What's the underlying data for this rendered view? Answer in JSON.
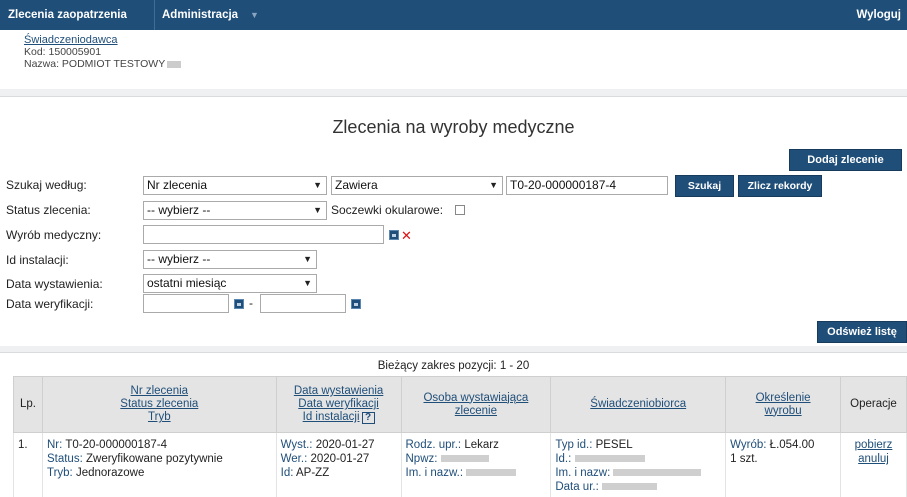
{
  "nav": {
    "orders": "Zlecenia zaopatrzenia",
    "admin": "Administracja",
    "logout": "Wyloguj"
  },
  "provider": {
    "label": "Świadczeniodawca",
    "code": "Kod: 150005901",
    "name": "Nazwa: PODMIOT TESTOWY"
  },
  "page_title": "Zlecenia na wyroby medyczne",
  "buttons": {
    "add": "Dodaj zlecenie",
    "search": "Szukaj",
    "count": "Zlicz rekordy",
    "refresh": "Odśwież listę"
  },
  "filters": {
    "search_by_label": "Szukaj według:",
    "search_by_value": "Nr zlecenia",
    "match_value": "Zawiera",
    "query_value": "T0-20-000000187-4",
    "status_label": "Status zlecenia:",
    "status_value": "-- wybierz --",
    "lenses_label": "Soczewki okularowe:",
    "product_label": "Wyrób medyczny:",
    "product_value": "",
    "install_label": "Id instalacji:",
    "install_value": "-- wybierz --",
    "issue_date_label": "Data wystawienia:",
    "issue_date_value": "ostatni miesiąc",
    "verify_date_label": "Data weryfikacji:",
    "date_sep": "-"
  },
  "range_text": "Bieżący zakres pozycji: 1 - 20",
  "table": {
    "headers": {
      "lp": "Lp.",
      "order_1": "Nr zlecenia",
      "order_2": "Status zlecenia",
      "order_3": "Tryb",
      "dates_1": "Data wystawienia",
      "dates_2": "Data weryfikacji",
      "dates_3": "Id instalacji",
      "help": "?",
      "issuer_1": "Osoba wystawiająca",
      "issuer_2": "zlecenie",
      "beneficiary": "Świadczeniobiorca",
      "product_1": "Określenie",
      "product_2": "wyrobu",
      "ops": "Operacje"
    },
    "rows": [
      {
        "lp": "1.",
        "nr_key": "Nr:",
        "nr": "T0-20-000000187-4",
        "status_key": "Status:",
        "status": "Zweryfikowane pozytywnie",
        "mode_key": "Tryb:",
        "mode": "Jednorazowe",
        "issued_key": "Wyst.:",
        "issued": "2020-01-27",
        "verified_key": "Wer.:",
        "verified": "2020-01-27",
        "id_key": "Id:",
        "id": "AP-ZZ",
        "role_key": "Rodz. upr.:",
        "role": "Lekarz",
        "npwz_key": "Npwz:",
        "issuer_name_key": "Im. i nazw.:",
        "id_type_key": "Typ id.:",
        "id_type": "PESEL",
        "benef_id_key": "Id.:",
        "benef_name_key": "Im. i nazw:",
        "birth_key": "Data ur.:",
        "product_key": "Wyrób:",
        "product": "Ł.054.00",
        "qty": "1 szt.",
        "op_download": "pobierz",
        "op_cancel": "anuluj"
      }
    ]
  }
}
